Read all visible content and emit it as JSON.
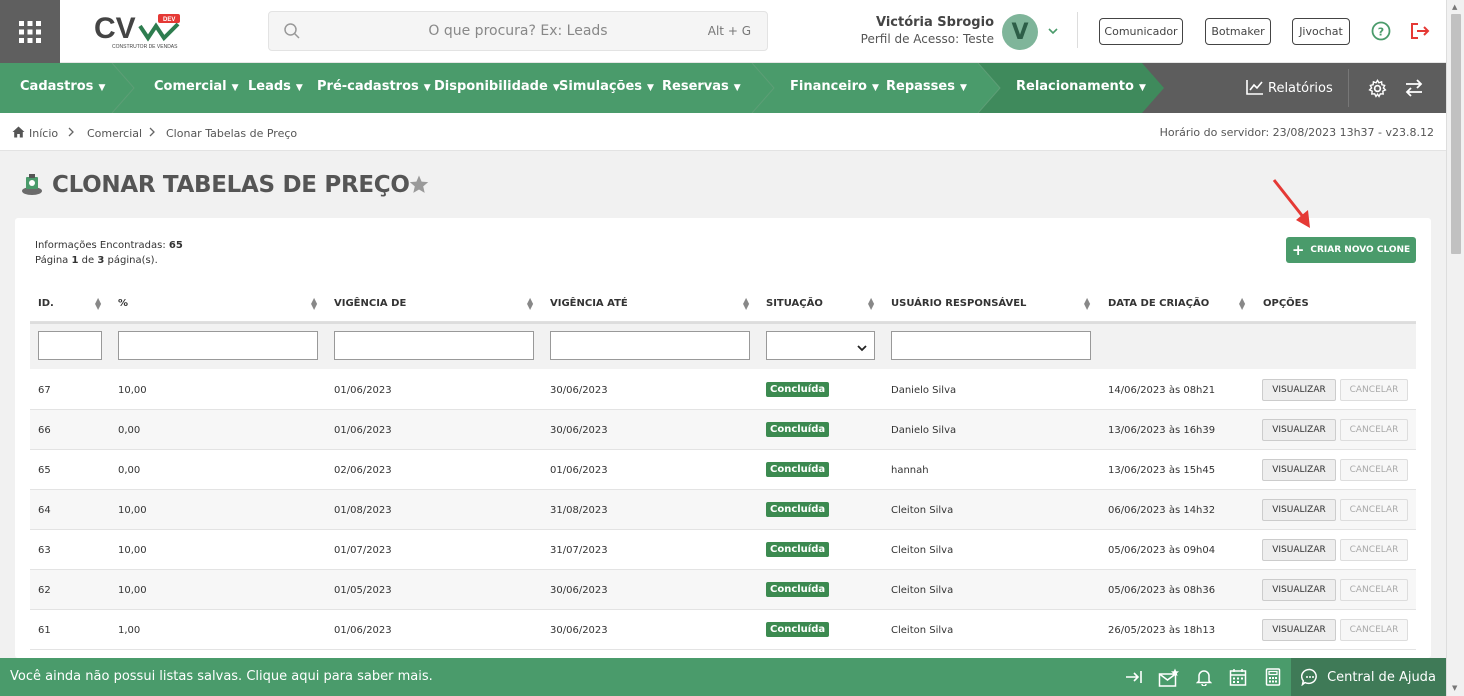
{
  "header": {
    "search_placeholder": "O que procura? Ex: Leads",
    "search_shortcut": "Alt + G",
    "user_name": "Victória Sbrogio",
    "user_profile": "Perfil de Acesso: Teste",
    "avatar_letter": "V",
    "buttons": [
      "Comunicador",
      "Botmaker",
      "Jivochat"
    ],
    "logo_text": "CV",
    "logo_badge": "DEV",
    "logo_sub": "CONSTRUTOR DE VENDAS"
  },
  "nav": {
    "items": [
      "Cadastros",
      "Comercial",
      "Leads",
      "Pré-cadastros",
      "Disponibilidade",
      "Simulações",
      "Reservas",
      "Financeiro",
      "Repasses",
      "Relacionamento"
    ],
    "reports": "Relatórios"
  },
  "breadcrumb": {
    "items": [
      "Início",
      "Comercial",
      "Clonar Tabelas de Preço"
    ],
    "server_time": "Horário do servidor: 23/08/2023 13h37 - v23.8.12"
  },
  "page": {
    "title": "CLONAR TABELAS DE PREÇO",
    "info_label": "Informações Encontradas:",
    "info_count": "65",
    "page_a": "Página",
    "page_num": "1",
    "page_b": "de",
    "page_total": "3",
    "page_c": "página(s).",
    "create_button": "CRIAR NOVO CLONE"
  },
  "table": {
    "headers": [
      "ID.",
      "%",
      "VIGÊNCIA DE",
      "VIGÊNCIA ATÉ",
      "SITUAÇÃO",
      "USUÁRIO RESPONSÁVEL",
      "DATA DE CRIAÇÃO",
      "OPÇÕES"
    ],
    "view_label": "VISUALIZAR",
    "cancel_label": "CANCELAR",
    "rows": [
      {
        "id": "67",
        "pct": "10,00",
        "from": "01/06/2023",
        "to": "30/06/2023",
        "status": "Concluída",
        "user": "Danielo Silva",
        "created": "14/06/2023 às 08h21"
      },
      {
        "id": "66",
        "pct": "0,00",
        "from": "01/06/2023",
        "to": "30/06/2023",
        "status": "Concluída",
        "user": "Danielo Silva",
        "created": "13/06/2023 às 16h39"
      },
      {
        "id": "65",
        "pct": "0,00",
        "from": "02/06/2023",
        "to": "01/06/2023",
        "status": "Concluída",
        "user": "hannah",
        "created": "13/06/2023 às 15h45"
      },
      {
        "id": "64",
        "pct": "10,00",
        "from": "01/08/2023",
        "to": "31/08/2023",
        "status": "Concluída",
        "user": "Cleiton Silva",
        "created": "06/06/2023 às 14h32"
      },
      {
        "id": "63",
        "pct": "10,00",
        "from": "01/07/2023",
        "to": "31/07/2023",
        "status": "Concluída",
        "user": "Cleiton Silva",
        "created": "05/06/2023 às 09h04"
      },
      {
        "id": "62",
        "pct": "10,00",
        "from": "01/05/2023",
        "to": "30/06/2023",
        "status": "Concluída",
        "user": "Cleiton Silva",
        "created": "05/06/2023 às 08h36"
      },
      {
        "id": "61",
        "pct": "1,00",
        "from": "01/06/2023",
        "to": "30/06/2023",
        "status": "Concluída",
        "user": "Cleiton Silva",
        "created": "26/05/2023 às 18h13"
      }
    ]
  },
  "footer": {
    "message": "Você ainda não possui listas salvas. Clique aqui para saber mais.",
    "help": "Central de Ajuda"
  },
  "colors": {
    "primary_green": "#4a9b6b",
    "dark_green": "#3c8a50",
    "nav_gray": "#5d5d5d",
    "danger_red": "#e53935"
  }
}
